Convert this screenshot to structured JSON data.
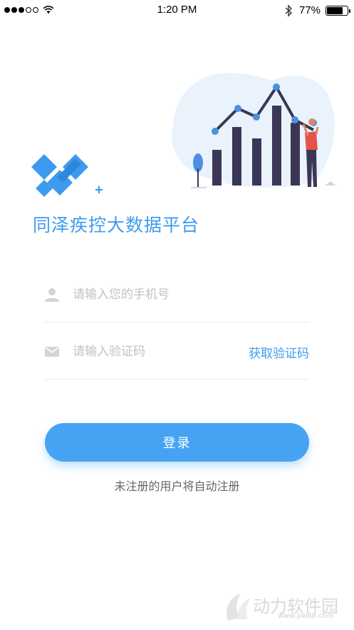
{
  "status_bar": {
    "time": "1:20 PM",
    "battery_percent": "77%",
    "battery_level": 0.77,
    "signal_bars_filled": 3,
    "signal_bars_total": 5
  },
  "app": {
    "title": "同泽疾控大数据平台",
    "accent_color": "#3d9bef"
  },
  "form": {
    "phone_placeholder": "请输入您的手机号",
    "phone_value": "",
    "code_placeholder": "请输入验证码",
    "code_value": "",
    "get_code_label": "获取验证码",
    "login_label": "登录",
    "register_note": "未注册的用户将自动注册"
  },
  "watermark": {
    "text": "动力软件园",
    "url": "www.pw88.com"
  }
}
